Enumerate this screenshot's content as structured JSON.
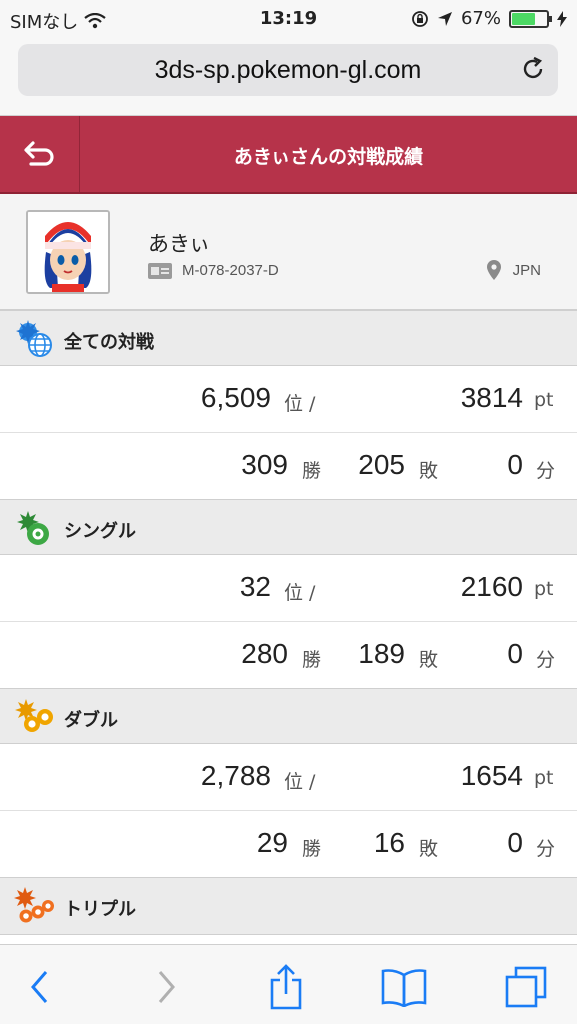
{
  "status": {
    "carrier": "SIMなし",
    "time": "13:19",
    "battery": "67%",
    "battery_level": 0.67
  },
  "browser": {
    "url": "3ds-sp.pokemon-gl.com"
  },
  "header": {
    "title": "あきぃさんの対戦成績"
  },
  "profile": {
    "name": "あきぃ",
    "id": "M-078-2037-D",
    "region": "JPN"
  },
  "sections": {
    "all": {
      "label": "全ての対戦",
      "rank": "6,509",
      "rank_unit": "位 /",
      "points": "3814",
      "points_unit": "pt",
      "wins": "309",
      "wins_unit": "勝",
      "losses": "205",
      "losses_unit": "敗",
      "draws": "0",
      "draws_unit": "分"
    },
    "single": {
      "label": "シングル",
      "rank": "32",
      "rank_unit": "位 /",
      "points": "2160",
      "points_unit": "pt",
      "wins": "280",
      "wins_unit": "勝",
      "losses": "189",
      "losses_unit": "敗",
      "draws": "0",
      "draws_unit": "分"
    },
    "double": {
      "label": "ダブル",
      "rank": "2,788",
      "rank_unit": "位 /",
      "points": "1654",
      "points_unit": "pt",
      "wins": "29",
      "wins_unit": "勝",
      "losses": "16",
      "losses_unit": "敗",
      "draws": "0",
      "draws_unit": "分"
    },
    "triple": {
      "label": "トリプル"
    }
  },
  "icons": {
    "wifi": "wifi-icon",
    "lock_rotation": "orientation-lock-icon",
    "location": "location-arrow-icon",
    "reload": "reload-icon",
    "back": "back-arrow-icon",
    "id_card": "id-card-icon",
    "pin": "location-pin-icon",
    "toolbar": [
      "back-chevron-icon",
      "forward-chevron-icon",
      "share-icon",
      "bookmarks-icon",
      "tabs-icon"
    ]
  },
  "colors": {
    "header_red": "#b6334a",
    "ios_blue": "#1a7cf5",
    "all_blue": "#2a8ae8",
    "single_green": "#3da845",
    "double_yellow": "#f0a500",
    "triple_orange": "#f07020"
  }
}
